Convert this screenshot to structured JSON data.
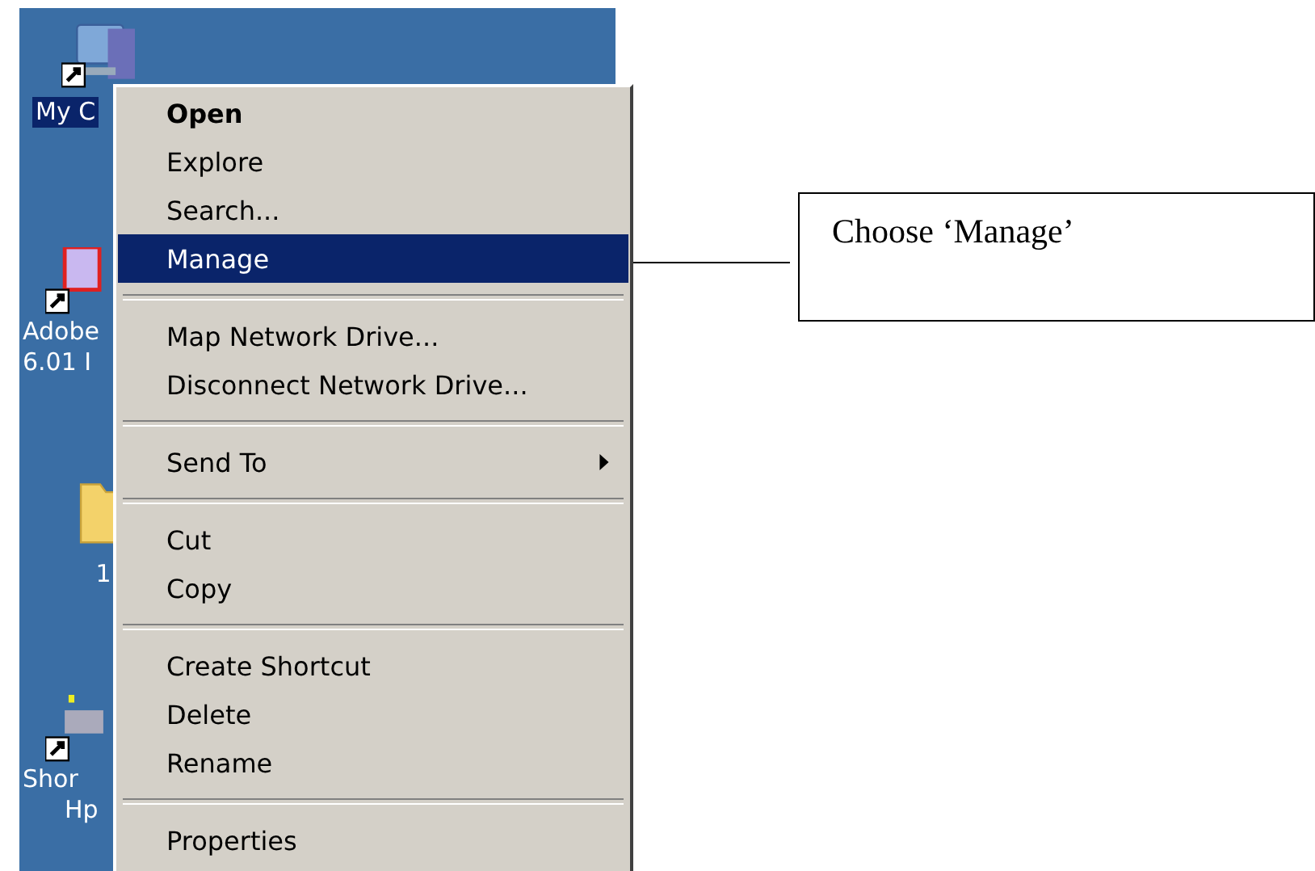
{
  "desktop_icons": [
    {
      "kind": "computer",
      "selected": true,
      "label_lines": [
        "My C"
      ]
    },
    {
      "kind": "document",
      "selected": false,
      "label_lines": [
        "Adobe",
        "6.01 I"
      ]
    },
    {
      "kind": "folder",
      "selected": false,
      "label_lines": [
        "1"
      ]
    },
    {
      "kind": "shortcut",
      "selected": false,
      "label_lines": [
        "Shor",
        "Hp"
      ]
    }
  ],
  "context_menu": {
    "items": [
      {
        "kind": "item",
        "label": "Open",
        "bold": true,
        "selected": false
      },
      {
        "kind": "item",
        "label": "Explore",
        "bold": false,
        "selected": false
      },
      {
        "kind": "item",
        "label": "Search...",
        "bold": false,
        "selected": false
      },
      {
        "kind": "item",
        "label": "Manage",
        "bold": false,
        "selected": true
      },
      {
        "kind": "separator"
      },
      {
        "kind": "item",
        "label": "Map Network Drive...",
        "bold": false,
        "selected": false
      },
      {
        "kind": "item",
        "label": "Disconnect Network Drive...",
        "bold": false,
        "selected": false
      },
      {
        "kind": "separator"
      },
      {
        "kind": "submenu",
        "label": "Send To",
        "bold": false,
        "selected": false
      },
      {
        "kind": "separator"
      },
      {
        "kind": "item",
        "label": "Cut",
        "bold": false,
        "selected": false
      },
      {
        "kind": "item",
        "label": "Copy",
        "bold": false,
        "selected": false
      },
      {
        "kind": "separator"
      },
      {
        "kind": "item",
        "label": "Create Shortcut",
        "bold": false,
        "selected": false
      },
      {
        "kind": "item",
        "label": "Delete",
        "bold": false,
        "selected": false
      },
      {
        "kind": "item",
        "label": "Rename",
        "bold": false,
        "selected": false
      },
      {
        "kind": "separator"
      },
      {
        "kind": "item",
        "label": "Properties",
        "bold": false,
        "selected": false
      }
    ]
  },
  "callout": {
    "text": "Choose ‘Manage’"
  }
}
